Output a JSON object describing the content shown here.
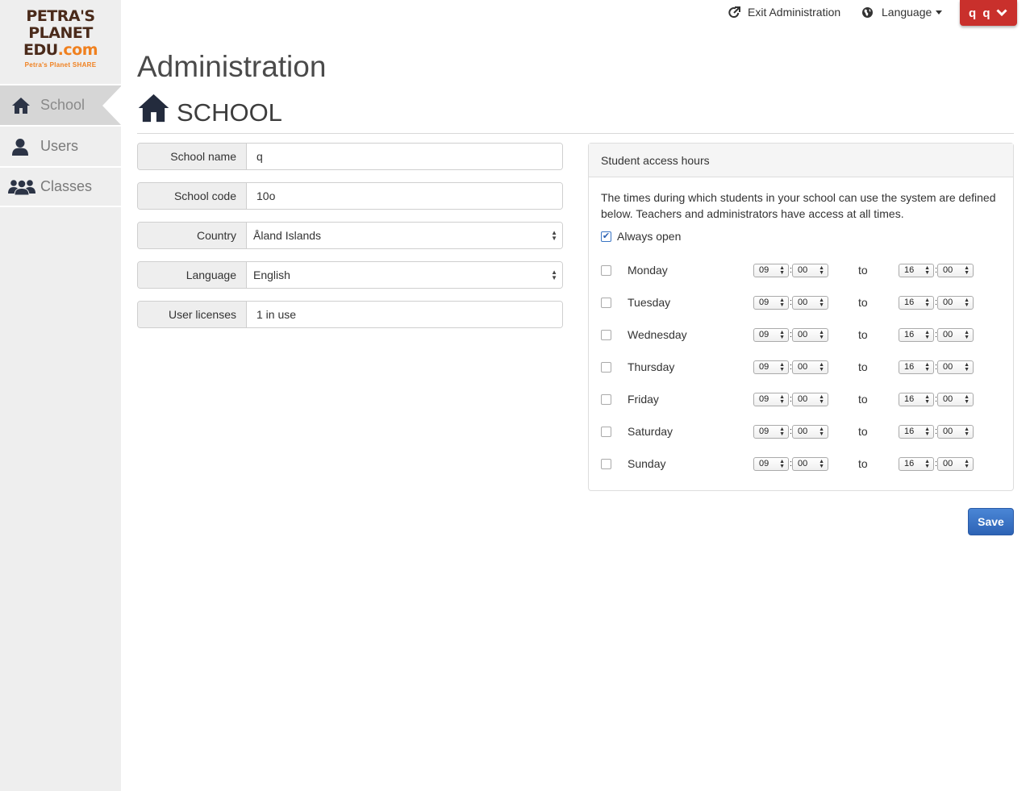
{
  "logo": {
    "line1": "PETRA'S",
    "line2": "PLANET",
    "line3_main": "EDU",
    "line3_suffix": ".com",
    "tagline": "Petra's Planet SHARE"
  },
  "sidebar": {
    "items": [
      {
        "label": "School",
        "icon": "home-icon",
        "active": true
      },
      {
        "label": "Users",
        "icon": "user-icon",
        "active": false
      },
      {
        "label": "Classes",
        "icon": "group-icon",
        "active": false
      }
    ]
  },
  "topbar": {
    "exit_label": "Exit Administration",
    "language_label": "Language",
    "user_initials": "q q"
  },
  "page": {
    "title": "Administration",
    "section_title": "SCHOOL"
  },
  "form": {
    "school_name": {
      "label": "School name",
      "value": "q"
    },
    "school_code": {
      "label": "School code",
      "value": "10o"
    },
    "country": {
      "label": "Country",
      "value": "Åland Islands"
    },
    "language": {
      "label": "Language",
      "value": "English"
    },
    "user_licenses": {
      "label": "User licenses",
      "value": "1 in use"
    }
  },
  "access": {
    "heading": "Student access hours",
    "description": "The times during which students in your school can use the system are defined below. Teachers and administrators have access at all times.",
    "always_open_label": "Always open",
    "always_open_checked": true,
    "to_label": "to",
    "days": [
      {
        "name": "Monday",
        "from_h": "09",
        "from_m": "00",
        "to_h": "16",
        "to_m": "00"
      },
      {
        "name": "Tuesday",
        "from_h": "09",
        "from_m": "00",
        "to_h": "16",
        "to_m": "00"
      },
      {
        "name": "Wednesday",
        "from_h": "09",
        "from_m": "00",
        "to_h": "16",
        "to_m": "00"
      },
      {
        "name": "Thursday",
        "from_h": "09",
        "from_m": "00",
        "to_h": "16",
        "to_m": "00"
      },
      {
        "name": "Friday",
        "from_h": "09",
        "from_m": "00",
        "to_h": "16",
        "to_m": "00"
      },
      {
        "name": "Saturday",
        "from_h": "09",
        "from_m": "00",
        "to_h": "16",
        "to_m": "00"
      },
      {
        "name": "Sunday",
        "from_h": "09",
        "from_m": "00",
        "to_h": "16",
        "to_m": "00"
      }
    ]
  },
  "actions": {
    "save_label": "Save"
  },
  "colors": {
    "sidebar_bg": "#eeeeee",
    "user_button": "#c9302c",
    "save_button": "#3a75c4",
    "logo_brown": "#4a2a1a",
    "logo_orange": "#f0801e"
  }
}
